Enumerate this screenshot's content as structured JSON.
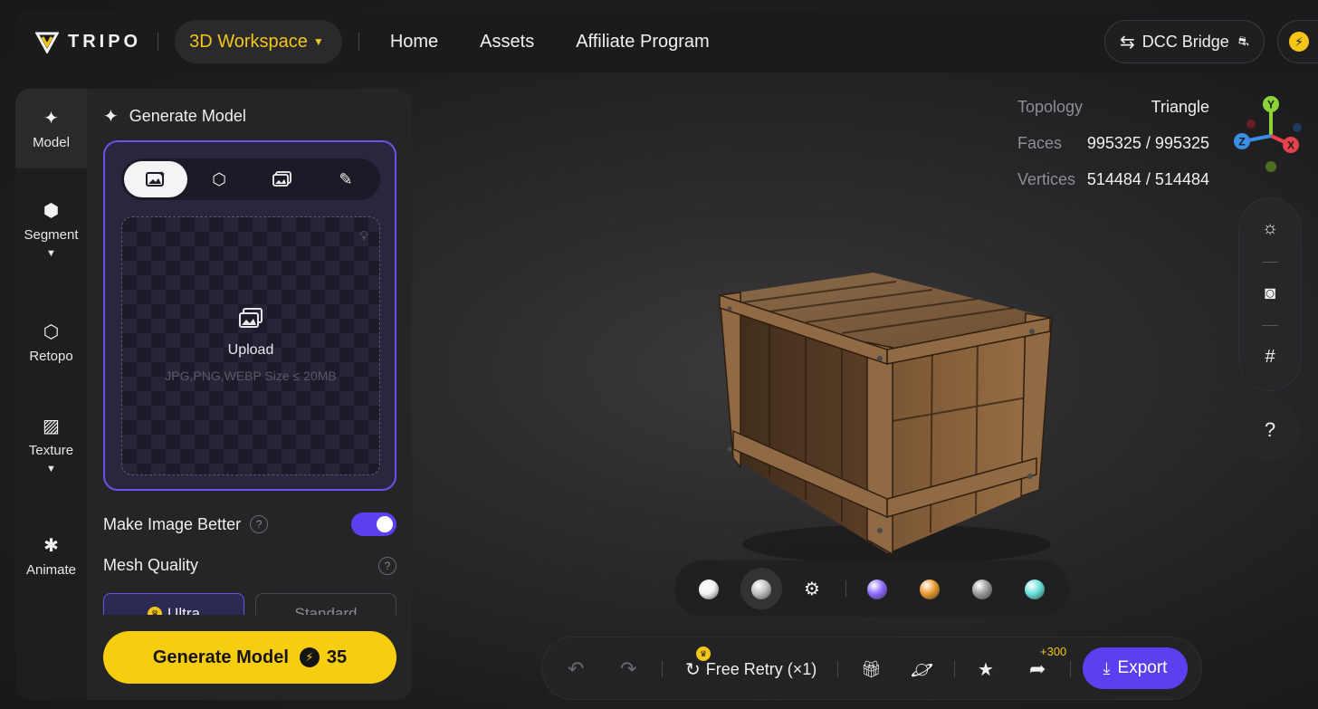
{
  "header": {
    "logo_text": "TRIPO",
    "workspace_label": "3D Workspace",
    "nav": [
      "Home",
      "Assets",
      "Affiliate Program"
    ],
    "dcc_label": "DCC Bridge"
  },
  "rail": {
    "items": [
      {
        "label": "Model",
        "icon": "sparkles-icon"
      },
      {
        "label": "Segment",
        "icon": "cube-icon"
      },
      {
        "label": "Retopo",
        "icon": "mesh-icon"
      },
      {
        "label": "Texture",
        "icon": "texture-icon"
      },
      {
        "label": "Animate",
        "icon": "figure-icon"
      }
    ]
  },
  "panel": {
    "title": "Generate Model",
    "upload_label": "Upload",
    "upload_hint": "JPG,PNG,WEBP Size ≤ 20MB",
    "make_better_label": "Make Image Better",
    "make_better_on": true,
    "mesh_quality_label": "Mesh Quality",
    "quality_options": [
      "Ultra",
      "Standard"
    ],
    "quality_selected": "Ultra",
    "generate_label": "Generate Model",
    "generate_cost": "35"
  },
  "stats": {
    "topology_label": "Topology",
    "topology_value": "Triangle",
    "faces_label": "Faces",
    "faces_value": "995325 / 995325",
    "vertices_label": "Vertices",
    "vertices_value": "514484 / 514484"
  },
  "gizmo": {
    "x": "X",
    "y": "Y",
    "z": "Z"
  },
  "help_label": "?",
  "materials": {
    "colors": [
      "#f2f2f2",
      "#bfbfbf",
      "#8e6cff",
      "#e89a2e",
      "#9a9a9a",
      "#66e0d8"
    ],
    "selected": 1
  },
  "actions": {
    "retry_label": "Free Retry (×1)",
    "bonus": "+300",
    "export_label": "Export"
  }
}
